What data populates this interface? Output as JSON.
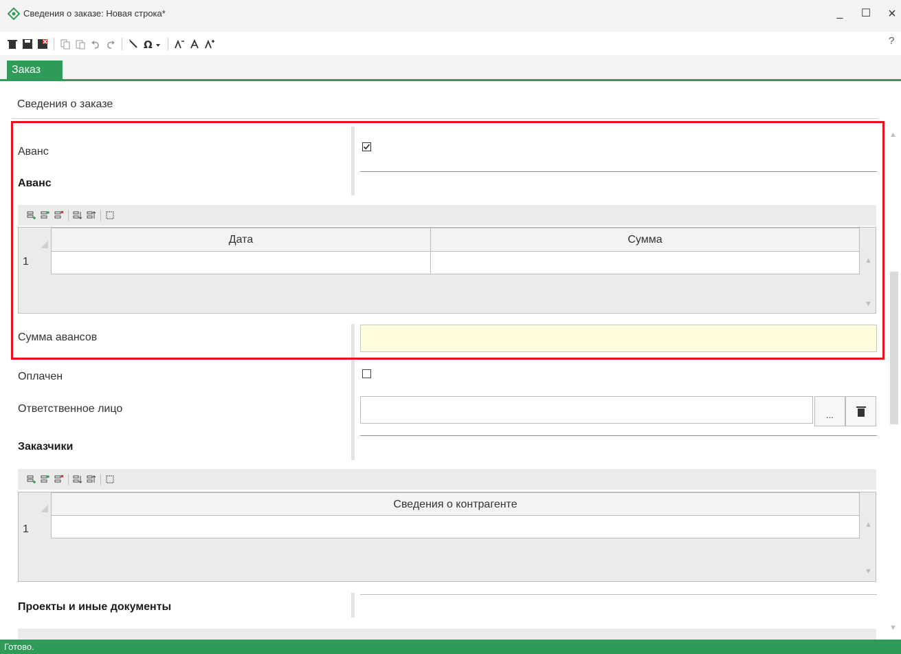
{
  "window": {
    "title": "Сведения о заказе: Новая строка*",
    "minimize": "_",
    "maximize": "☐",
    "close": "×",
    "help": "?"
  },
  "tabs": [
    {
      "label": "Заказ",
      "active": true
    }
  ],
  "section": {
    "title": "Сведения о заказе"
  },
  "form": {
    "avans_label": "Аванс",
    "avans_checked": true,
    "avans_section_heading": "Аванс",
    "avans_grid": {
      "columns": [
        "Дата",
        "Сумма"
      ],
      "rows": [
        {
          "num": "1",
          "cells": [
            "",
            ""
          ]
        }
      ]
    },
    "summa_avansov_label": "Сумма авансов",
    "summa_avansov_value": "",
    "oplachen_label": "Оплачен",
    "oplachen_checked": false,
    "responsible_label": "Ответственное лицо",
    "responsible_value": "",
    "browse_button": "...",
    "zakazchiki_heading": "Заказчики",
    "zakazchiki_grid": {
      "columns": [
        "Сведения о контрагенте"
      ],
      "rows": [
        {
          "num": "1",
          "cells": [
            ""
          ]
        }
      ]
    },
    "projects_heading": "Проекты и иные документы"
  },
  "status": {
    "text": "Готово."
  },
  "colors": {
    "accent": "#2e9b58",
    "highlight": "#e3141b",
    "computed_field": "#fffddc"
  }
}
